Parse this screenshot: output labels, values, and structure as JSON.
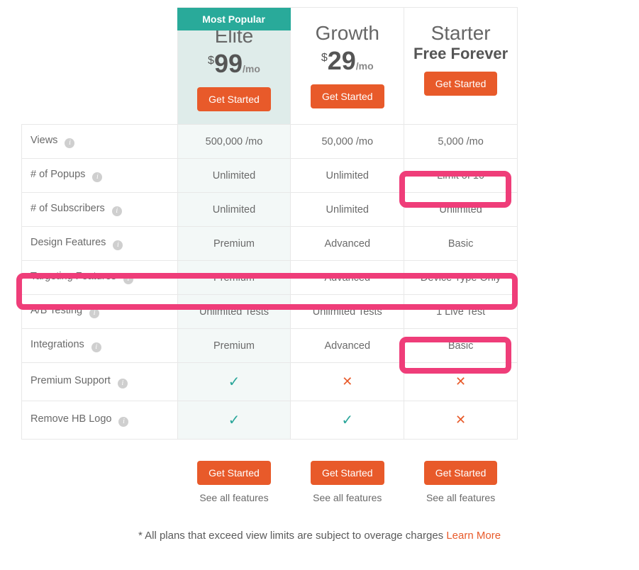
{
  "badge": "Most Popular",
  "currency": "$",
  "suffix": "/mo",
  "cta": "Get Started",
  "see_all": "See all features",
  "plans": {
    "elite": {
      "name": "Elite",
      "price": "99"
    },
    "growth": {
      "name": "Growth",
      "price": "29"
    },
    "starter": {
      "name": "Starter",
      "subtitle": "Free Forever"
    }
  },
  "rows": [
    {
      "label": "Views",
      "elite": "500,000 /mo",
      "growth": "50,000 /mo",
      "starter": "5,000 /mo"
    },
    {
      "label": "# of Popups",
      "elite": "Unlimited",
      "growth": "Unlimited",
      "starter": "Limit of 10"
    },
    {
      "label": "# of Subscribers",
      "elite": "Unlimited",
      "growth": "Unlimited",
      "starter": "Unlimited"
    },
    {
      "label": "Design Features",
      "elite": "Premium",
      "growth": "Advanced",
      "starter": "Basic"
    },
    {
      "label": "Targeting Features",
      "elite": "Premium",
      "growth": "Advanced",
      "starter": "Device Type Only"
    },
    {
      "label": "A/B Testing",
      "elite": "Unlimited Tests",
      "growth": "Unlimited Tests",
      "starter": "1 Live Test"
    },
    {
      "label": "Integrations",
      "elite": "Premium",
      "growth": "Advanced",
      "starter": "Basic"
    },
    {
      "label": "Premium Support",
      "elite": "✓",
      "growth": "✕",
      "starter": "✕"
    },
    {
      "label": "Remove HB Logo",
      "elite": "✓",
      "growth": "✓",
      "starter": "✕"
    }
  ],
  "disclaimer": "* All plans that exceed view limits are subject to overage charges ",
  "learn_more": "Learn More"
}
